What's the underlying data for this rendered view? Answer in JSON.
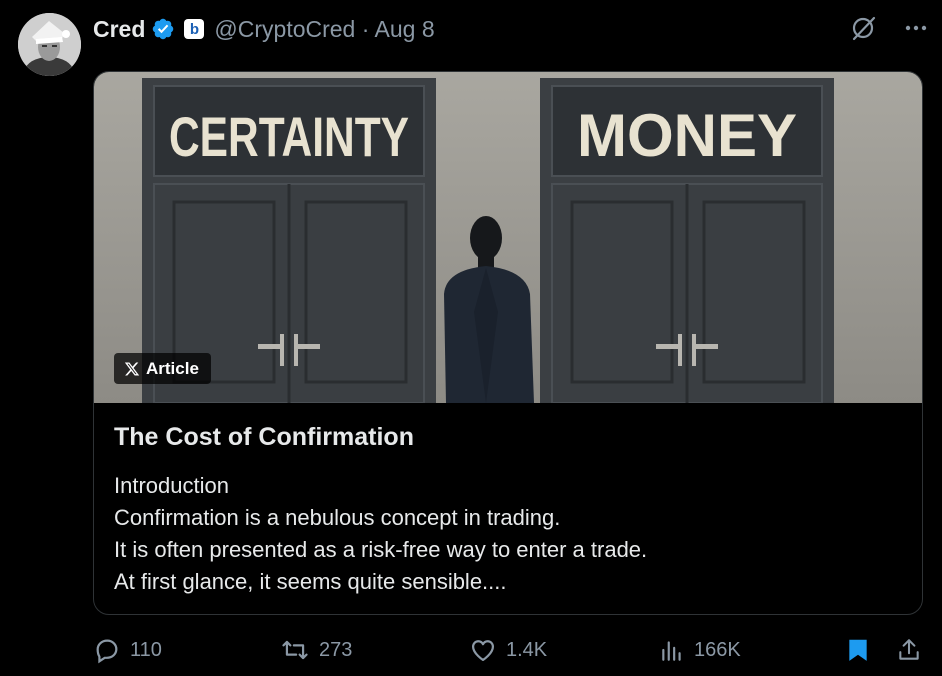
{
  "tweet": {
    "author_name": "Cred",
    "handle_date": "@CryptoCred · Aug 8",
    "badge_letter": "b"
  },
  "card": {
    "pill_label": "Article",
    "image_door_left": "CERTAINTY",
    "image_door_right": "MONEY",
    "title": "The Cost of Confirmation",
    "body_lines": [
      "Introduction",
      "Confirmation is a nebulous concept in trading.",
      "It is often presented as a risk-free way to enter a trade.",
      "At first glance, it seems quite sensible...."
    ]
  },
  "actions": {
    "replies": "110",
    "reposts": "273",
    "likes": "1.4K",
    "views": "166K"
  },
  "colors": {
    "background": "#000000",
    "text": "#e7e9ea",
    "muted": "#8b98a5",
    "accent": "#1d9bf0",
    "border": "#2f3336"
  },
  "icons": [
    "verified-icon",
    "grok-icon",
    "more-icon",
    "reply-icon",
    "repost-icon",
    "like-icon",
    "views-icon",
    "bookmark-icon",
    "share-icon",
    "x-logo-icon"
  ]
}
